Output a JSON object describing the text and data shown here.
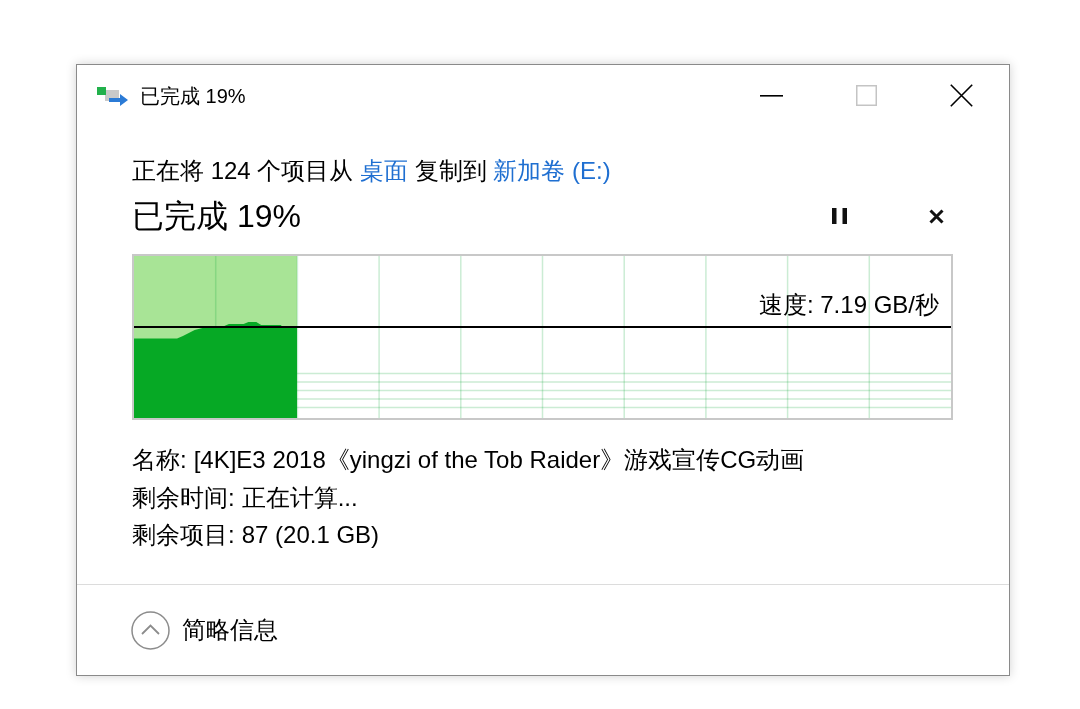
{
  "window": {
    "title": "已完成 19%",
    "maximize_disabled": true
  },
  "copy": {
    "summary": [
      {
        "kind": "text",
        "text": "正在将 124 个项目从"
      },
      {
        "kind": "link",
        "text": "桌面"
      },
      {
        "kind": "text",
        "text": "复制到"
      },
      {
        "kind": "link",
        "text": "新加卷 (E:)"
      }
    ],
    "status": "已完成 19%",
    "paused": false
  },
  "graph": {
    "progress": {
      "level": 0.2
    },
    "speed": "速度: 7.19 GB/秒"
  },
  "details": [
    {
      "label": "名称:",
      "value": "[4K]E3 2018《yingzi of the Tob Raider》游戏宣传CG动画"
    },
    {
      "label": "剩余时间:",
      "value": "正在计算..."
    },
    {
      "label": "剩余项目:",
      "value": "87 (20.1 GB)"
    }
  ],
  "details_toggle": {
    "label": "简略信息",
    "expanded": true
  }
}
